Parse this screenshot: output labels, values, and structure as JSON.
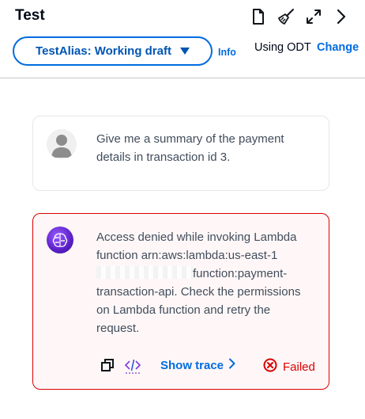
{
  "header": {
    "title": "Test",
    "icons": [
      "document-icon",
      "broom-icon",
      "expand-icon",
      "chevron-right-icon"
    ]
  },
  "alias": {
    "label": "TestAlias: Working draft",
    "info_label": "Info"
  },
  "odt": {
    "label": "Using ODT",
    "change_label": "Change"
  },
  "messages": {
    "user": {
      "text": "Give me a summary of the payment details in transaction id 3."
    },
    "bot": {
      "text_part1": "Access denied while invoking Lambda function arn:aws:lambda:us-east-1",
      "text_part2": "function:payment-transaction-api. Check the permissions on Lambda function and retry the request.",
      "show_trace_label": "Show trace",
      "status_label": "Failed"
    }
  },
  "colors": {
    "accent": "#006ce0",
    "error": "#db0000",
    "error_bg": "#fff7f7"
  }
}
